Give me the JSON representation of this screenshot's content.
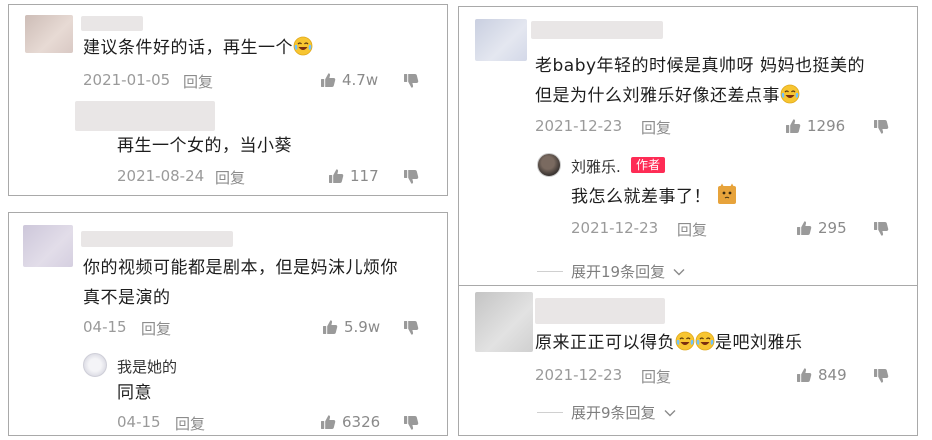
{
  "cards": {
    "c1": {
      "comment": {
        "text": "建议条件好的话，再生一个",
        "date": "2021-01-05",
        "reply": "回复",
        "likes": "4.7w"
      },
      "sub": {
        "text": "再生一个女的，当小葵",
        "date": "2021-08-24",
        "reply": "回复",
        "likes": "117"
      }
    },
    "c2": {
      "comment": {
        "line1": "你的视频可能都是剧本，但是妈沫儿烦你",
        "line2": "真不是演的",
        "date": "04-15",
        "reply": "回复",
        "likes": "5.9w"
      },
      "sub": {
        "user": "我是她的",
        "text": "同意",
        "date": "04-15",
        "reply": "回复",
        "likes": "6326"
      }
    },
    "c3": {
      "comment": {
        "line1": "老baby年轻的时候是真帅呀 妈妈也挺美的",
        "line2": "但是为什么刘雅乐好像还差点事",
        "date": "2021-12-23",
        "reply": "回复",
        "likes": "1296"
      },
      "sub": {
        "user": "刘雅乐.",
        "author_tag": "作者",
        "text": "我怎么就差事了！",
        "date": "2021-12-23",
        "reply": "回复",
        "likes": "295"
      },
      "expand": "展开19条回复"
    },
    "c4": {
      "comment": {
        "text_a": "原来正正可以得负",
        "text_b": "是吧刘雅乐",
        "date": "2021-12-23",
        "reply": "回复",
        "likes": "849"
      },
      "expand": "展开9条回复"
    }
  },
  "colors": {
    "accent": "#fe2c55",
    "meta": "#9a9a9a",
    "border": "#a9a9a9"
  },
  "icons": [
    "thumb-up-icon",
    "thumb-down-icon",
    "laugh-cry-emoji",
    "cat-emoji",
    "chevron-down-icon"
  ]
}
